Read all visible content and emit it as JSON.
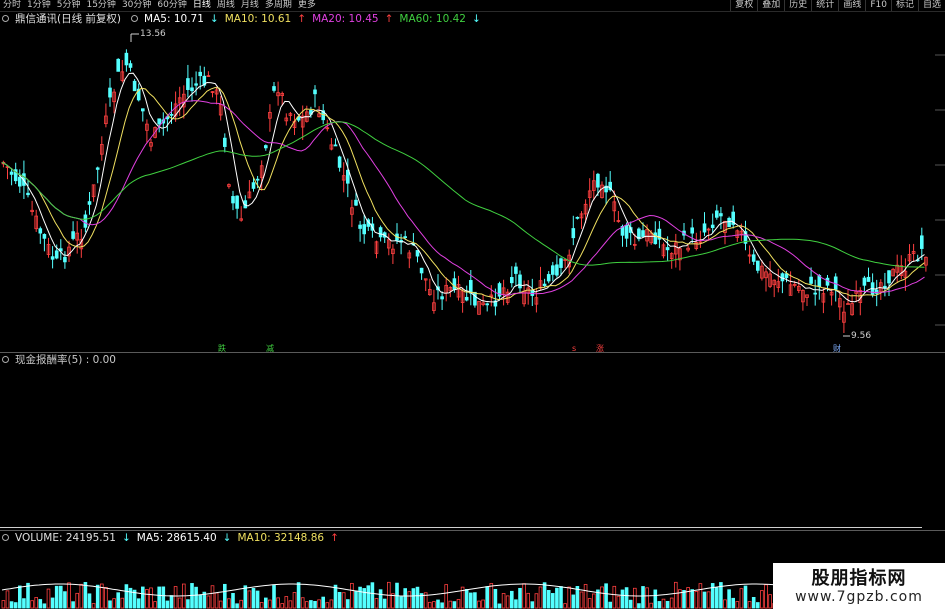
{
  "top_tabs": [
    "分时",
    "1分钟",
    "5分钟",
    "15分钟",
    "30分钟",
    "60分钟",
    "日线",
    "周线",
    "月线",
    "多周期",
    "更多"
  ],
  "active_tab": "日线",
  "toolbar": [
    "复权",
    "叠加",
    "历史",
    "统计",
    "画线",
    "F10",
    "标记",
    "自选"
  ],
  "price_panel": {
    "title": "鼎信通讯(日线 前复权)",
    "ma": [
      {
        "label": "MA5: 10.71",
        "arrow": "↓",
        "color": "#ffffff"
      },
      {
        "label": "MA10: 10.61",
        "arrow": "↑",
        "color": "#f0e060"
      },
      {
        "label": "MA20: 10.45",
        "arrow": "↑",
        "color": "#e040e0"
      },
      {
        "label": "MA60: 10.42",
        "arrow": "↓",
        "color": "#40d040"
      }
    ],
    "high_label": "13.56",
    "low_label": "9.56",
    "marks": [
      {
        "text": "跌",
        "color": "#40d040"
      },
      {
        "text": "减",
        "color": "#40d040"
      },
      {
        "text": "s",
        "color": "#ff4040"
      },
      {
        "text": "涨",
        "color": "#ff4040"
      },
      {
        "text": "财",
        "color": "#80b0ff"
      }
    ]
  },
  "indicator_panel": {
    "label": "现金报酬率(5) : 0.00"
  },
  "volume_panel": {
    "volume": "VOLUME: 24195.51",
    "volume_arrow": "↓",
    "ma5": "MA5: 28615.40",
    "ma5_arrow": "↓",
    "ma10": "MA10: 32148.86",
    "ma10_arrow": "↑"
  },
  "colors": {
    "up": "#ff4040",
    "down": "#54ffff",
    "ma5": "#ffffff",
    "ma10": "#f0e060",
    "ma20": "#e040e0",
    "ma60": "#40d040"
  },
  "watermark": {
    "line1": "股朋指标网",
    "line2": "www.7gpzb.com"
  }
}
